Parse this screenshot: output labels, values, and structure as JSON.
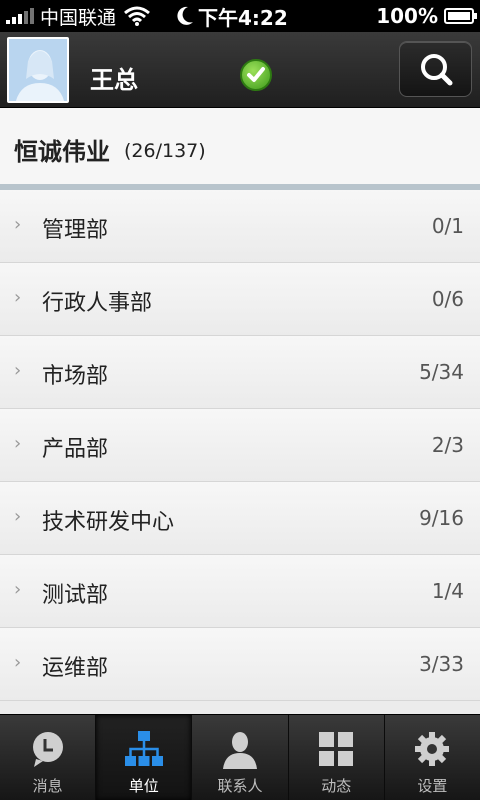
{
  "status_bar": {
    "carrier": "中国联通",
    "time": "下午4:22",
    "battery": "100%"
  },
  "header": {
    "username": "王总"
  },
  "company": {
    "name": "恒诚伟业",
    "count": "(26/137)"
  },
  "departments": [
    {
      "name": "管理部",
      "ratio": "0/1"
    },
    {
      "name": "行政人事部",
      "ratio": "0/6"
    },
    {
      "name": "市场部",
      "ratio": "5/34"
    },
    {
      "name": "产品部",
      "ratio": "2/3"
    },
    {
      "name": "技术研发中心",
      "ratio": "9/16"
    },
    {
      "name": "测试部",
      "ratio": "1/4"
    },
    {
      "name": "运维部",
      "ratio": "3/33"
    }
  ],
  "tabs": [
    {
      "label": "消息",
      "icon": "message-icon"
    },
    {
      "label": "单位",
      "icon": "org-chart-icon"
    },
    {
      "label": "联系人",
      "icon": "contact-icon"
    },
    {
      "label": "动态",
      "icon": "grid-icon"
    },
    {
      "label": "设置",
      "icon": "gear-icon"
    }
  ],
  "active_tab": "单位",
  "colors": {
    "accent_blue": "#2a8ee8",
    "online_green": "#4fb220"
  }
}
